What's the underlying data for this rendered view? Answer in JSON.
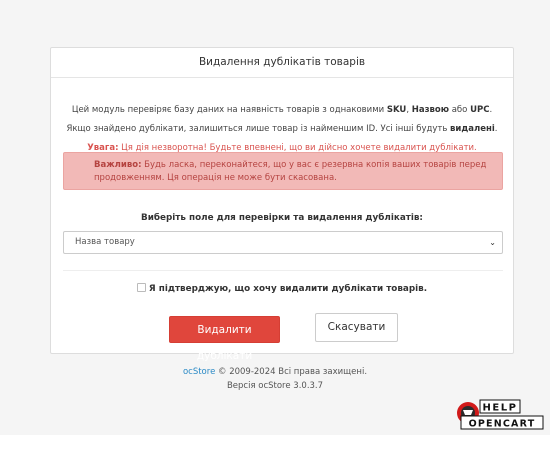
{
  "panel": {
    "title": "Видалення дублікатів товарів",
    "line1": {
      "pre": "Цей модуль перевіряє базу даних на наявність товарів з однаковими ",
      "b1": "SKU",
      "sep1": ", ",
      "b2": "Назвою",
      "sep2": " або ",
      "b3": "UPC",
      "post": "."
    },
    "line2": {
      "pre": "Якщо знайдено дублікати, залишиться лише товар із найменшим ID. Усі інші будуть ",
      "b": "видалені",
      "post": "."
    },
    "line3": {
      "b": "Увага:",
      "text": " Ця дія незворотна! Будьте впевнені, що ви дійсно хочете видалити дублікати."
    },
    "alert": {
      "b": "Важливо:",
      "text": " Будь ласка, переконайтеся, що у вас є резервна копія ваших товарів перед продовженням. Ця операція не може бути скасована."
    },
    "field_label": "Виберіть поле для перевірки та видалення дублікатів:",
    "select_value": "Назва товару",
    "confirm_label": "Я підтверджую, що хочу видалити дублікати товарів.",
    "delete_button": "Видалити дублікати",
    "cancel_button": "Скасувати"
  },
  "footer": {
    "brand": "ocStore",
    "copyright": " © 2009-2024 Всі права захищені.",
    "version": "Версія ocStore 3.0.3.7"
  },
  "logo": {
    "top_text": "HELP",
    "bottom_text": "OPENCART",
    "icon": "opencart-cart-icon"
  },
  "colors": {
    "danger": "#e0463c",
    "alert_bg": "#f2b9b7",
    "link": "#2a8ac6"
  }
}
